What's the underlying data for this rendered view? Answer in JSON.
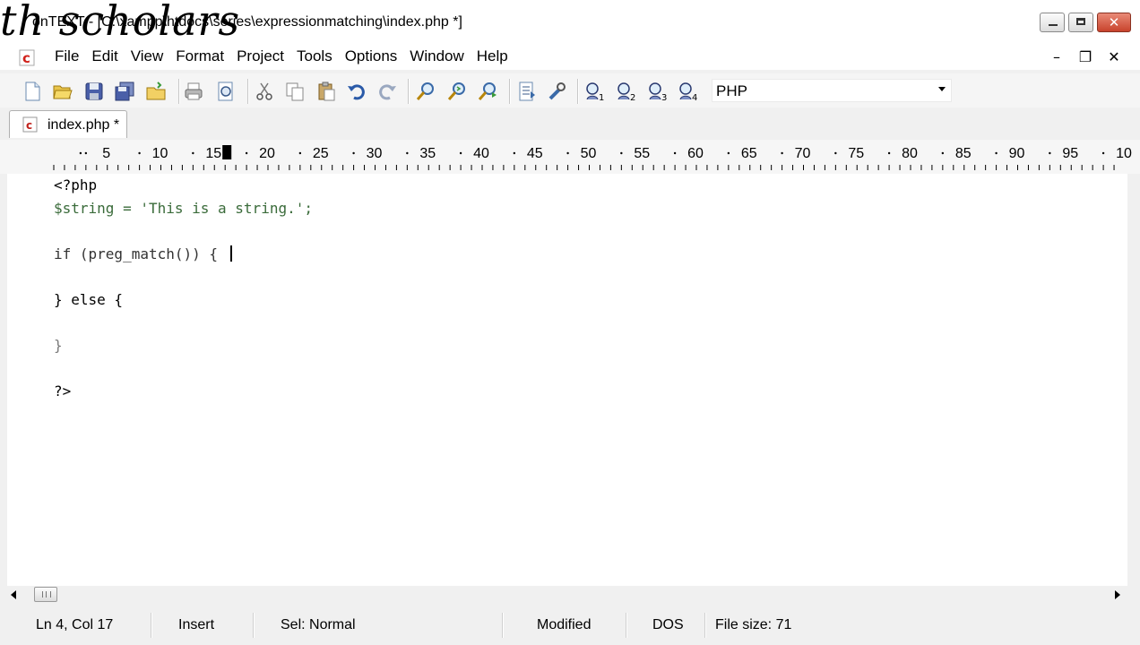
{
  "window": {
    "title": "onTEXT - [C:\\xampp\\htdocs\\series\\expressionmatching\\index.php *]",
    "watermark": "th scholars",
    "buttons": [
      "minimize",
      "maximize",
      "close"
    ]
  },
  "menu": {
    "items": [
      "File",
      "Edit",
      "View",
      "Format",
      "Project",
      "Tools",
      "Options",
      "Window",
      "Help"
    ],
    "mdi_minimize": "–",
    "mdi_restore": "❐",
    "mdi_close": "✕"
  },
  "toolbar": {
    "icons": [
      "new-file-icon",
      "open-folder-icon",
      "save-icon",
      "save-all-icon",
      "open-project-icon",
      "print-icon",
      "print-preview-icon",
      "cut-icon",
      "copy-icon",
      "paste-icon",
      "undo-icon",
      "redo-icon",
      "find-icon",
      "find-next-icon",
      "replace-icon",
      "document-properties-icon",
      "tools-icon",
      "user-tool-1-icon",
      "user-tool-2-icon",
      "user-tool-3-icon",
      "user-tool-4-icon"
    ],
    "language": "PHP"
  },
  "tabs": [
    {
      "label": "index.php *",
      "active": true
    }
  ],
  "ruler": {
    "labels": [
      "5",
      "10",
      "15",
      "20",
      "25",
      "30",
      "35",
      "40",
      "45",
      "50",
      "55",
      "60",
      "65",
      "70",
      "75",
      "80",
      "85",
      "90",
      "95",
      "10"
    ],
    "cursor_column": 17
  },
  "editor": {
    "lines": [
      "<?php",
      "$string = 'This is a string.';",
      "",
      "if (preg_match()) {",
      "",
      "} else {",
      "",
      "}",
      "",
      "?>"
    ]
  },
  "status": {
    "position": "Ln 4, Col 17",
    "mode": "Insert",
    "selection": "Sel: Normal",
    "modified": "Modified",
    "line_endings": "DOS",
    "file_size": "File size: 71"
  },
  "colors": {
    "variable": "#3a6b3a",
    "string": "#9a1a1a",
    "punctuation": "#7a7a7a",
    "close_button": "#c8432c"
  }
}
